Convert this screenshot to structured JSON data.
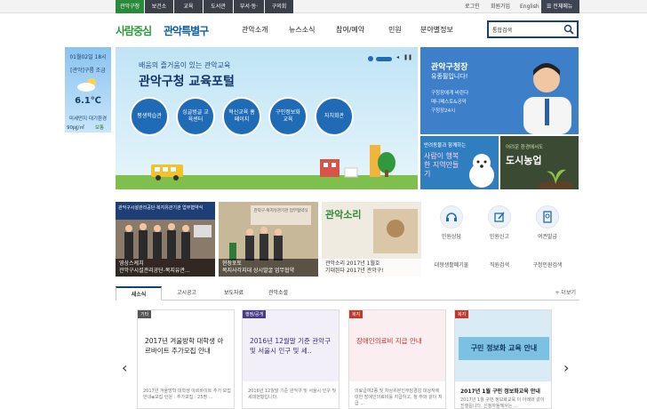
{
  "topbar": {
    "tabs": [
      "관악구청",
      "보건소",
      "교육",
      "도서관",
      "부서·동·",
      "구의회"
    ],
    "login": "로그인",
    "join": "회원가입",
    "english": "English",
    "menu": "전체메뉴"
  },
  "header": {
    "logo_slogan": "사람중심",
    "logo_name": "관악특별구",
    "nav": [
      "관악소개",
      "뉴스소식",
      "참여/예약",
      "민원",
      "분야별정보"
    ],
    "search_value": "통합검색"
  },
  "weather": {
    "date": "01월02일 18시",
    "location": "[관악]구름 조금",
    "temp": "6.1℃",
    "dust_label": "미세먼지 대기환경",
    "dust_value": "90㎍/㎥",
    "dust_status": "보통"
  },
  "banner": {
    "subtitle": "배움의 즐거움이 있는 관악교육",
    "title": "관악구청 교육포털",
    "circles": [
      "평생학습관",
      "싱글벙글 교육센터",
      "혁신교육 홈페이지",
      "구민정보화 교육",
      "자치회관"
    ]
  },
  "mayor": {
    "title": "관악구청장",
    "subtitle": "유종필입니다!",
    "lines": [
      "구청장에게 바란다",
      "매니페스토&공약",
      "구청장24시"
    ]
  },
  "promos": [
    {
      "small": "반려동물과 함께하는",
      "big": "사람이 행복한 지역만들기"
    },
    {
      "small": "어려운 환경에서도",
      "big": "도시농업"
    }
  ],
  "news": [
    {
      "caption1": "영상스케치",
      "caption2": "관악구시설관리공단-복지유관…",
      "sign": "관악구시설관리공단·복지유관기관 업무협약식"
    },
    {
      "caption1": "현장포토",
      "caption2": "복지사각지대 상시발굴 업무협약",
      "sign": "관악구·복지유관기관 업무협약식"
    },
    {
      "caption1": "관악소리 2017년 1월호",
      "caption2": "기대된다 2017년 관악구!",
      "mag": "관악소리"
    }
  ],
  "quick": [
    "민원상담",
    "민원신고",
    "여권발급",
    "대형생활폐기물",
    "직원검색",
    "구청민원검색"
  ],
  "tabs": [
    "새소식",
    "고시공고",
    "보도자료",
    "관악소셜"
  ],
  "more": "+ 더보기",
  "cards": [
    {
      "badge": "기타",
      "title": "2017년 겨울방학 대학생 아르바이트 추가모집 안내",
      "desc": "2017년 겨울방학 대학생 아르바이트 추가 모집 안내◈모집 인원 : 추가모집 : 25명 …"
    },
    {
      "badge": "행정/공개",
      "title": "2016년 12월말 기준 관악구 및 서울시 인구 및 세..",
      "desc": "2016년 12월말 기준 관악구 및 서울시 인구 및 세대현황입니다."
    },
    {
      "badge": "복지",
      "title": "장애인의료비 지급 안내",
      "desc": "의료급여2종 및 차상위본인부담경감 대상자에 대한 장애인의료비를 지급하고, 청 부와 같이 지급 …"
    },
    {
      "badge": "복지",
      "title": "2017년 1월 구민 정보화교육 안내",
      "image_text": "구민 정보화 교육 안내",
      "desc": "2017년 1월 구민 정보화교육 이 아래와 같이 진행됩니다. 신청자들께서는 …"
    }
  ],
  "colors": {
    "green": "#2f9a3c",
    "navy": "#1a3f73",
    "blue": "#1f6bb5"
  }
}
